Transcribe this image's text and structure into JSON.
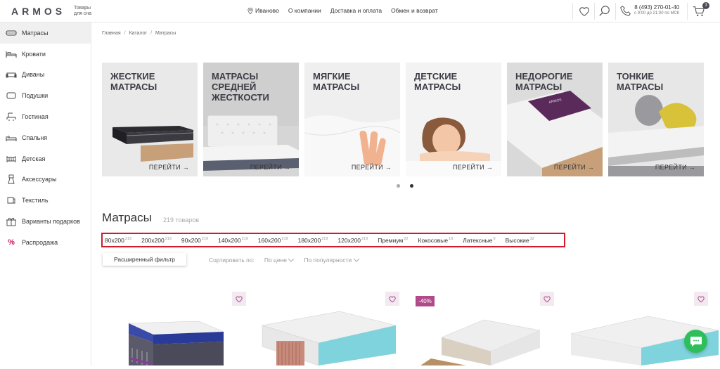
{
  "header": {
    "logo": "ARMOS",
    "tagline_1": "Товары",
    "tagline_2": "для сна",
    "nav": [
      "Иваново",
      "О компании",
      "Доставка и оплата",
      "Обмен и возврат"
    ],
    "phone": "8 (493) 270-01-40",
    "hours": "с 9:00 до 21:00 по МСК",
    "cart_count": "3"
  },
  "sidebar": {
    "items": [
      {
        "label": "Матрасы",
        "icon": "mattress-icon"
      },
      {
        "label": "Кровати",
        "icon": "bed-icon"
      },
      {
        "label": "Диваны",
        "icon": "sofa-icon"
      },
      {
        "label": "Подушки",
        "icon": "pillow-icon"
      },
      {
        "label": "Гостиная",
        "icon": "armchair-icon"
      },
      {
        "label": "Спальня",
        "icon": "bedroom-icon"
      },
      {
        "label": "Детская",
        "icon": "crib-icon"
      },
      {
        "label": "Аксессуары",
        "icon": "accessory-icon"
      },
      {
        "label": "Текстиль",
        "icon": "textile-icon"
      },
      {
        "label": "Варианты подарков",
        "icon": "gift-icon"
      },
      {
        "label": "Распродажа",
        "icon": "percent-icon"
      }
    ]
  },
  "breadcrumb": [
    "Главная",
    "Каталог",
    "Матрасы"
  ],
  "cards": [
    {
      "title": "ЖЕСТКИЕ МАТРАСЫ",
      "cta": "ПЕРЕЙТИ →"
    },
    {
      "title": "МАТРАСЫ СРЕДНЕЙ ЖЕСТКОСТИ",
      "cta": "ПЕРЕЙТИ →"
    },
    {
      "title": "МЯГКИЕ МАТРАСЫ",
      "cta": "ПЕРЕЙТИ →"
    },
    {
      "title": "ДЕТСКИЕ МАТРАСЫ",
      "cta": "ПЕРЕЙТИ →"
    },
    {
      "title": "НЕДОРОГИЕ МАТРАСЫ",
      "cta": "ПЕРЕЙТИ →"
    },
    {
      "title": "ТОНКИЕ МАТРАСЫ",
      "cta": "ПЕРЕЙТИ →"
    }
  ],
  "page": {
    "title": "Матрасы",
    "count": "219 товаров"
  },
  "chips": [
    {
      "label": "80x200",
      "count": "219"
    },
    {
      "label": "200x200",
      "count": "219"
    },
    {
      "label": "90x200",
      "count": "219"
    },
    {
      "label": "140x200",
      "count": "219"
    },
    {
      "label": "160x200",
      "count": "219"
    },
    {
      "label": "180x200",
      "count": "219"
    },
    {
      "label": "120x200",
      "count": "219"
    },
    {
      "label": "Премиум",
      "count": "22"
    },
    {
      "label": "Кокосовые",
      "count": "19"
    },
    {
      "label": "Латексные",
      "count": "9"
    },
    {
      "label": "Высокие",
      "count": "32"
    }
  ],
  "filter": {
    "button": "Расширенный фильтр",
    "sort_label": "Сортировать по:",
    "sort_price": "По цене",
    "sort_popular": "По популярности"
  },
  "products": {
    "discount_badge": "-40%"
  },
  "colors": {
    "brand": "#4a4a55",
    "accent": "#b04a8a",
    "highlight": "#d21a2a",
    "chat": "#2ebf5a"
  }
}
